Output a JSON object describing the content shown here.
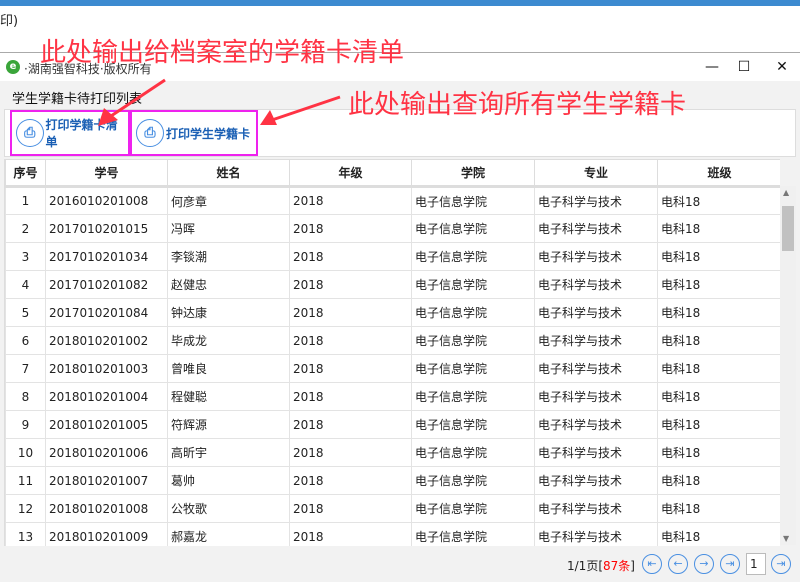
{
  "background": {
    "text": "印)"
  },
  "window": {
    "title": "·湖南强智科技·版权所有",
    "minimize": "—",
    "maximize": "☐",
    "close": "✕"
  },
  "list_label": "学生学籍卡待打印列表",
  "toolbar": {
    "print_list": "打印学籍卡清单",
    "print_card": "打印学生学籍卡"
  },
  "annotations": {
    "first": "此处输出给档案室的学籍卡清单",
    "second": "此处输出查询所有学生学籍卡"
  },
  "table": {
    "headers": [
      "序号",
      "学号",
      "姓名",
      "年级",
      "学院",
      "专业",
      "班级"
    ],
    "rows": [
      [
        "1",
        "2016010201008",
        "何彦章",
        "2018",
        "电子信息学院",
        "电子科学与技术",
        "电科18"
      ],
      [
        "2",
        "2017010201015",
        "冯晖",
        "2018",
        "电子信息学院",
        "电子科学与技术",
        "电科18"
      ],
      [
        "3",
        "2017010201034",
        "李锬潮",
        "2018",
        "电子信息学院",
        "电子科学与技术",
        "电科18"
      ],
      [
        "4",
        "2017010201082",
        "赵健忠",
        "2018",
        "电子信息学院",
        "电子科学与技术",
        "电科18"
      ],
      [
        "5",
        "2017010201084",
        "钟达康",
        "2018",
        "电子信息学院",
        "电子科学与技术",
        "电科18"
      ],
      [
        "6",
        "2018010201002",
        "毕成龙",
        "2018",
        "电子信息学院",
        "电子科学与技术",
        "电科18"
      ],
      [
        "7",
        "2018010201003",
        "曾唯良",
        "2018",
        "电子信息学院",
        "电子科学与技术",
        "电科18"
      ],
      [
        "8",
        "2018010201004",
        "程健聪",
        "2018",
        "电子信息学院",
        "电子科学与技术",
        "电科18"
      ],
      [
        "9",
        "2018010201005",
        "符辉源",
        "2018",
        "电子信息学院",
        "电子科学与技术",
        "电科18"
      ],
      [
        "10",
        "2018010201006",
        "高昕宇",
        "2018",
        "电子信息学院",
        "电子科学与技术",
        "电科18"
      ],
      [
        "11",
        "2018010201007",
        "葛帅",
        "2018",
        "电子信息学院",
        "电子科学与技术",
        "电科18"
      ],
      [
        "12",
        "2018010201008",
        "公牧歌",
        "2018",
        "电子信息学院",
        "电子科学与技术",
        "电科18"
      ],
      [
        "13",
        "2018010201009",
        "郝嘉龙",
        "2018",
        "电子信息学院",
        "电子科学与技术",
        "电科18"
      ]
    ]
  },
  "pager": {
    "pages": "1/1页[",
    "count": "87条",
    "close_bracket": "]",
    "current_page": "1",
    "first": "⇤",
    "prev": "←",
    "next": "→",
    "last": "⇥",
    "go": "⇥"
  }
}
